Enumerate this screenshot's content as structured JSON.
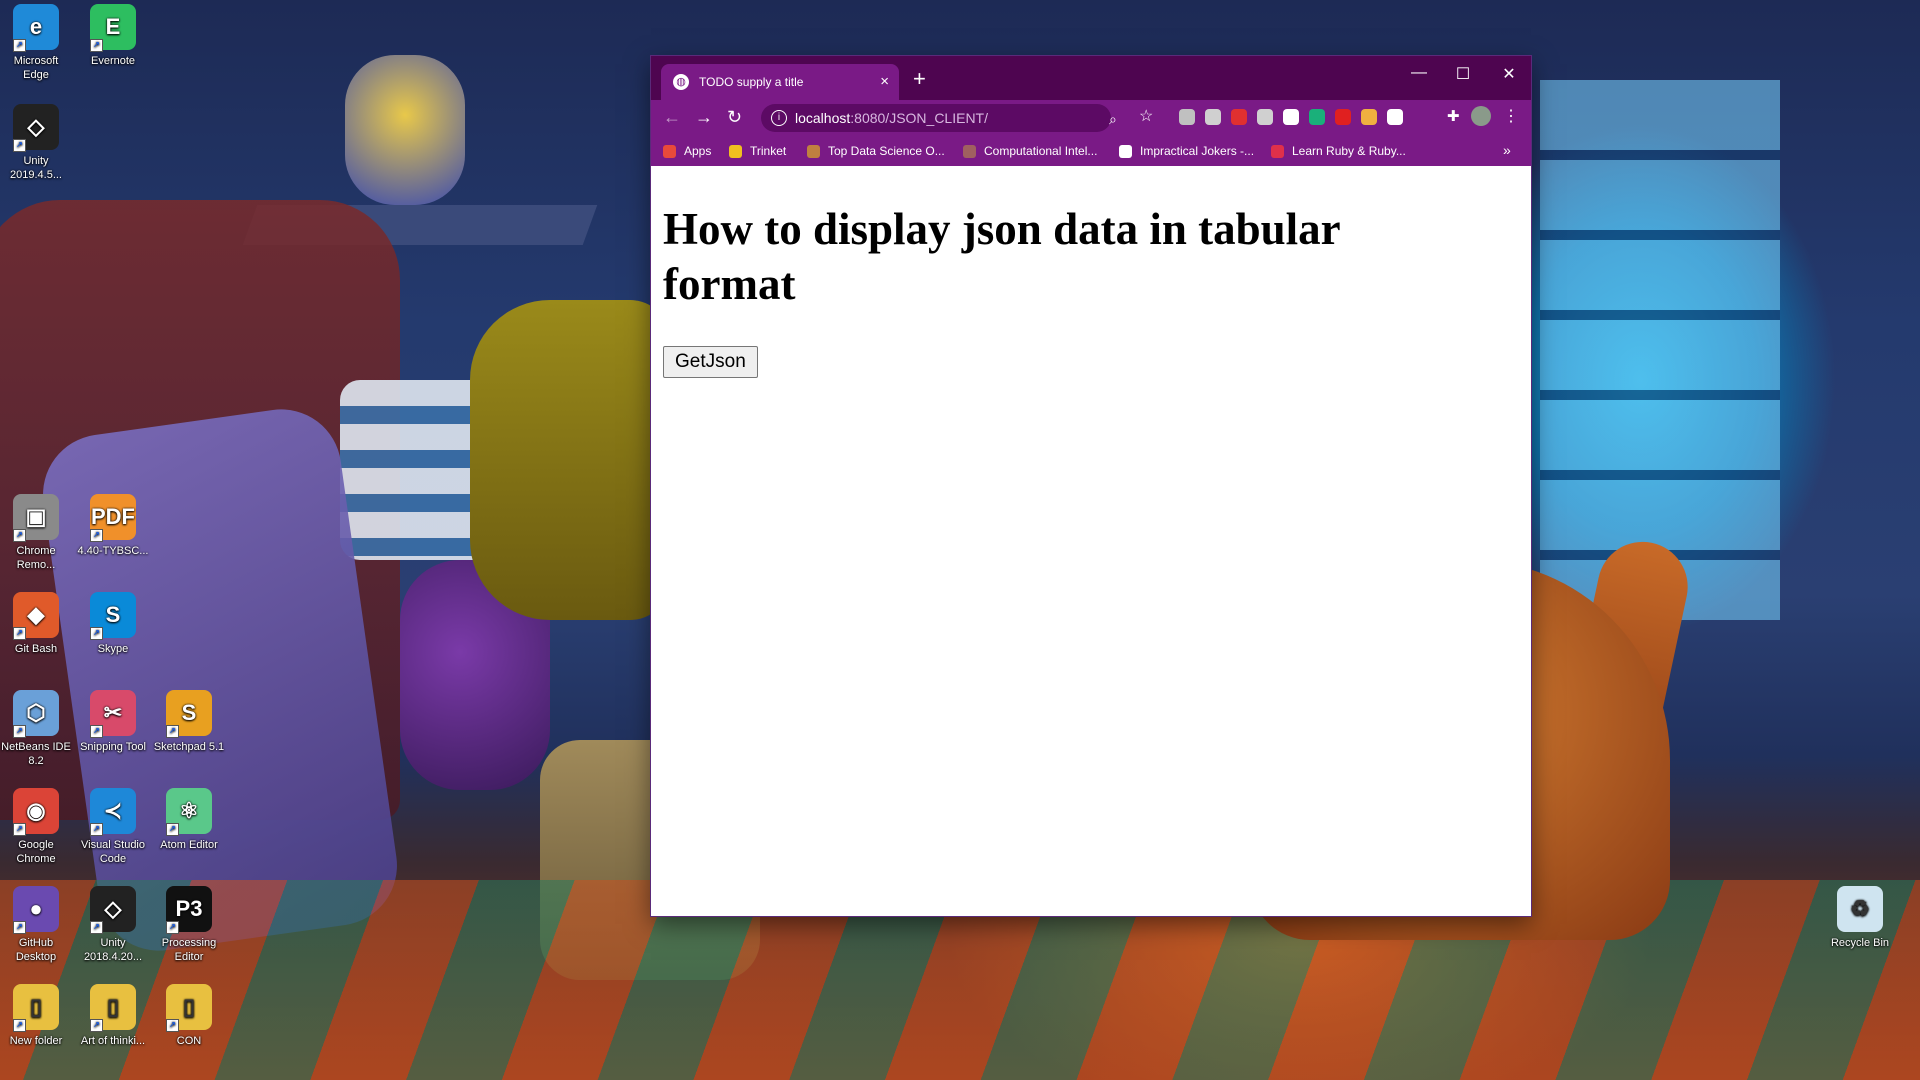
{
  "desktop": {
    "icons": [
      {
        "label": "Microsoft Edge",
        "color": "#1f8ad8",
        "glyph": "e"
      },
      {
        "label": "Evernote",
        "color": "#2dbe60",
        "glyph": "E"
      },
      {
        "label": "Unity 2019.4.5...",
        "color": "#222222",
        "glyph": "◇"
      },
      {
        "label": "Chrome Remo...",
        "color": "#8a8a8a",
        "glyph": "▣"
      },
      {
        "label": "4.40-TYBSC...",
        "color": "#f0902a",
        "glyph": "PDF"
      },
      {
        "label": "Git Bash",
        "color": "#e05a2a",
        "glyph": "◆"
      },
      {
        "label": "Skype",
        "color": "#0a8ad8",
        "glyph": "S"
      },
      {
        "label": "NetBeans IDE 8.2",
        "color": "#6aa0d8",
        "glyph": "⬡"
      },
      {
        "label": "Snipping Tool",
        "color": "#d84a6a",
        "glyph": "✂"
      },
      {
        "label": "Sketchpad 5.1",
        "color": "#e8a020",
        "glyph": "S"
      },
      {
        "label": "Google Chrome",
        "color": "#db4437",
        "glyph": "◉"
      },
      {
        "label": "Visual Studio Code",
        "color": "#1e88d8",
        "glyph": "≺"
      },
      {
        "label": "Atom Editor",
        "color": "#5ac88a",
        "glyph": "⚛"
      },
      {
        "label": "GitHub Desktop",
        "color": "#6a4ab0",
        "glyph": "●"
      },
      {
        "label": "Unity 2018.4.20...",
        "color": "#222222",
        "glyph": "◇"
      },
      {
        "label": "Processing Editor",
        "color": "#111111",
        "glyph": "P3"
      },
      {
        "label": "New folder",
        "color": "#e8c040",
        "glyph": "▯"
      },
      {
        "label": "Art of thinki...",
        "color": "#e8c040",
        "glyph": "▯"
      },
      {
        "label": "CON",
        "color": "#e8c040",
        "glyph": "▯"
      },
      {
        "label": "Recycle Bin",
        "color": "#cfe4f0",
        "glyph": "♻"
      }
    ]
  },
  "browser": {
    "tab_title": "TODO supply a title",
    "tab_close": "×",
    "new_tab": "+",
    "window_controls": {
      "minimize": "—",
      "maximize": "☐",
      "close": "✕"
    },
    "nav": {
      "back": "←",
      "forward": "→",
      "reload": "↻"
    },
    "url_host": "localhost",
    "url_rest": ":8080/JSON_CLIENT/",
    "extensions_colors": [
      "#c0c0c0",
      "#d0d0d0",
      "#e03030",
      "#d0d0d0",
      "#ffffff",
      "#1ab07a",
      "#e02020",
      "#f0b040",
      "#ffffff"
    ],
    "bookmarks": [
      {
        "label": "Apps",
        "color": "#e84a3a"
      },
      {
        "label": "Trinket",
        "color": "#f0c020"
      },
      {
        "label": "Top Data Science O...",
        "color": "#c08040"
      },
      {
        "label": "Computational Intel...",
        "color": "#a06060"
      },
      {
        "label": "Impractical Jokers -...",
        "color": "#ffffff"
      },
      {
        "label": "Learn Ruby & Ruby...",
        "color": "#e0304a"
      }
    ],
    "bookmarks_overflow": "»"
  },
  "page": {
    "heading": "How to display json data in tabular format",
    "button_label": "GetJson"
  }
}
